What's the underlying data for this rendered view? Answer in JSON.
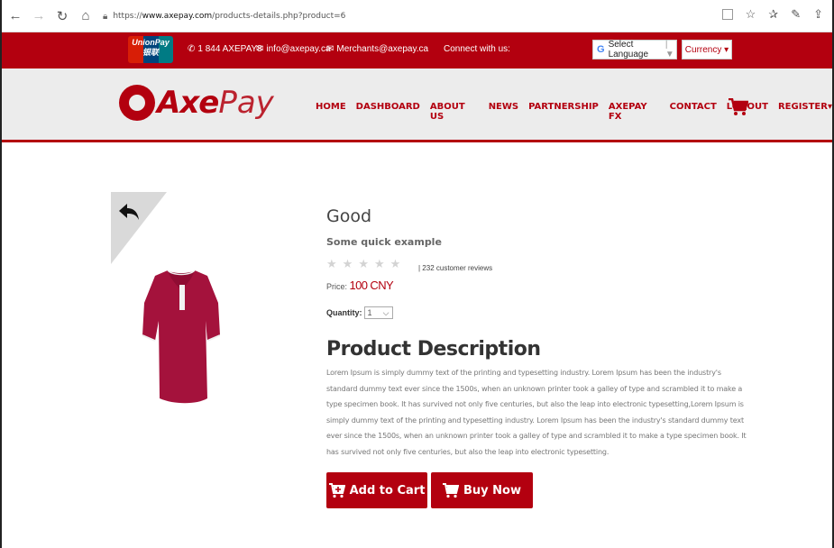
{
  "browser": {
    "url_prefix": "https://",
    "url_host": "www.axepay.com",
    "url_path": "/products-details.php?product=6"
  },
  "topbar": {
    "unionpay_text": "UnionPay",
    "unionpay_cn": "银联",
    "phone": "1 844 AXEPAY8",
    "email_info": "info@axepay.ca",
    "email_merchants": "Merchants@axepay.ca",
    "connect": "Connect with us:",
    "language": "Select Language",
    "currency": "Currency"
  },
  "logo": {
    "axe": "Axe",
    "pay": "Pay"
  },
  "menu": [
    "HOME",
    "DASHBOARD",
    "ABOUT US",
    "NEWS",
    "PARTNERSHIP",
    "AXEPAY FX",
    "CONTACT",
    "LOGOUT",
    "REGISTER"
  ],
  "product": {
    "title": "Good",
    "subtitle": "Some quick example",
    "rating": 0,
    "reviews": "| 232 customer reviews",
    "price_label": "Price:",
    "price_value": "100 CNY",
    "quantity_label": "Quantity:",
    "quantity_value": "1",
    "desc_title": "Product Description",
    "description": "Lorem Ipsum is simply dummy text of the printing and typesetting industry. Lorem Ipsum has been the industry's standard dummy text ever since the 1500s, when an unknown printer took a galley of type and scrambled it to make a type specimen book. It has survived not only five centuries, but also the leap into electronic typesetting,Lorem Ipsum is simply dummy text of the printing and typesetting industry. Lorem Ipsum has been the industry's standard dummy text ever since the 1500s, when an unknown printer took a galley of type and scrambled it to make a type specimen book. It has survived not only five centuries, but also the leap into electronic typesetting.",
    "add_to_cart": "Add to Cart",
    "buy_now": "Buy Now"
  },
  "colors": {
    "brand": "#b3000f",
    "nav_bg": "#ececec"
  }
}
